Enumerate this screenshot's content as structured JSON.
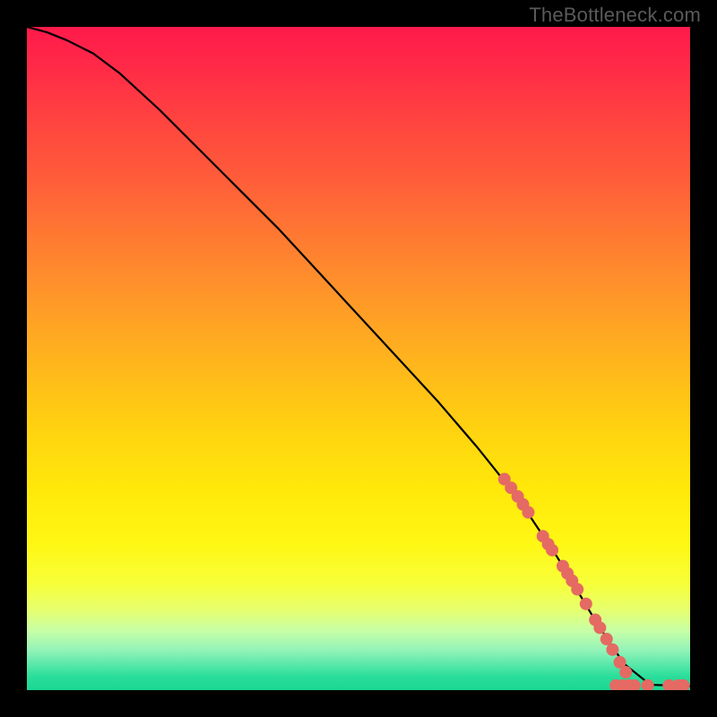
{
  "watermark": "TheBottleneck.com",
  "chart_data": {
    "type": "line",
    "title": "",
    "xlabel": "",
    "ylabel": "",
    "xlim": [
      0,
      100
    ],
    "ylim": [
      0,
      100
    ],
    "grid": false,
    "series": [
      {
        "name": "bottleneck-curve",
        "x": [
          0,
          3,
          6,
          10,
          14,
          20,
          26,
          32,
          38,
          44,
          50,
          56,
          62,
          68,
          72,
          76,
          80,
          83,
          86,
          90,
          94,
          100
        ],
        "y": [
          100,
          99.2,
          98,
          96,
          93,
          87.5,
          81.5,
          75.5,
          69.5,
          63,
          56.5,
          50,
          43.5,
          36.5,
          31.5,
          26,
          20,
          15,
          10,
          4,
          0.8,
          0.6
        ]
      }
    ],
    "markers": {
      "name": "highlighted-points",
      "color": "#e46a63",
      "radius_px": 7,
      "points": [
        {
          "x": 72.0,
          "y": 31.8
        },
        {
          "x": 73.0,
          "y": 30.5
        },
        {
          "x": 74.0,
          "y": 29.2
        },
        {
          "x": 74.8,
          "y": 28.0
        },
        {
          "x": 75.6,
          "y": 26.8
        },
        {
          "x": 77.8,
          "y": 23.2
        },
        {
          "x": 78.6,
          "y": 22.0
        },
        {
          "x": 79.2,
          "y": 21.1
        },
        {
          "x": 80.8,
          "y": 18.7
        },
        {
          "x": 81.5,
          "y": 17.6
        },
        {
          "x": 82.2,
          "y": 16.5
        },
        {
          "x": 83.0,
          "y": 15.2
        },
        {
          "x": 84.3,
          "y": 13.0
        },
        {
          "x": 85.7,
          "y": 10.6
        },
        {
          "x": 86.4,
          "y": 9.4
        },
        {
          "x": 87.4,
          "y": 7.7
        },
        {
          "x": 88.3,
          "y": 6.1
        },
        {
          "x": 89.4,
          "y": 4.2
        },
        {
          "x": 90.3,
          "y": 2.7
        },
        {
          "x": 88.8,
          "y": 0.7
        },
        {
          "x": 89.8,
          "y": 0.7
        },
        {
          "x": 90.8,
          "y": 0.7
        },
        {
          "x": 91.6,
          "y": 0.7
        },
        {
          "x": 93.6,
          "y": 0.7
        },
        {
          "x": 96.8,
          "y": 0.7
        },
        {
          "x": 98.2,
          "y": 0.7
        },
        {
          "x": 99.0,
          "y": 0.7
        }
      ]
    },
    "background_gradient": {
      "direction": "top-to-bottom",
      "stops": [
        {
          "pos": 0.0,
          "color": "#ff1a4b"
        },
        {
          "pos": 0.3,
          "color": "#ff7433"
        },
        {
          "pos": 0.6,
          "color": "#ffd60f"
        },
        {
          "pos": 0.85,
          "color": "#f0ff55"
        },
        {
          "pos": 1.0,
          "color": "#1ad893"
        }
      ]
    }
  }
}
